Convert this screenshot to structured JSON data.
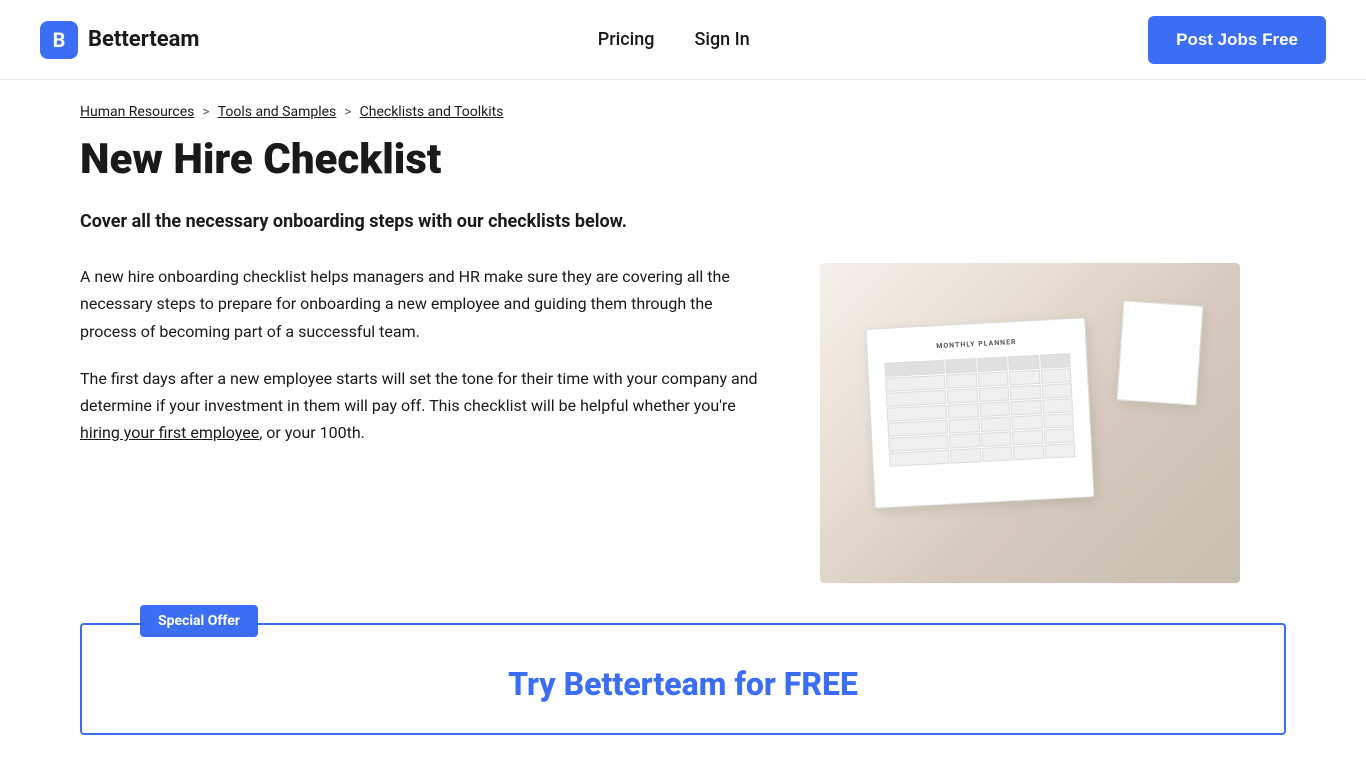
{
  "header": {
    "logo_text": "Betterteam",
    "logo_letter": "B",
    "nav": {
      "pricing_label": "Pricing",
      "signin_label": "Sign In"
    },
    "cta_button": "Post Jobs Free"
  },
  "breadcrumb": {
    "item1": "Human Resources",
    "separator1": ">",
    "item2": "Tools and Samples",
    "separator2": ">",
    "item3": "Checklists and Toolkits"
  },
  "main": {
    "page_title": "New Hire Checklist",
    "subtitle": "Cover all the necessary onboarding steps with our checklists below.",
    "paragraph1": "A new hire onboarding checklist helps managers and HR make sure they are covering all the necessary steps to prepare for onboarding a new employee and guiding them through the process of becoming part of a successful team.",
    "paragraph2_part1": "The first days after a new employee starts will set the tone for their time with your company and determine if your investment in them will pay off. This checklist will be helpful whether you're",
    "inline_link": "hiring your first employee",
    "paragraph2_part2": ", or your 100th."
  },
  "special_offer": {
    "tag": "Special Offer",
    "title": "Try Betterteam for FREE"
  },
  "colors": {
    "accent": "#3b6ef5",
    "text_dark": "#1a1a1a",
    "text_muted": "#666666"
  }
}
